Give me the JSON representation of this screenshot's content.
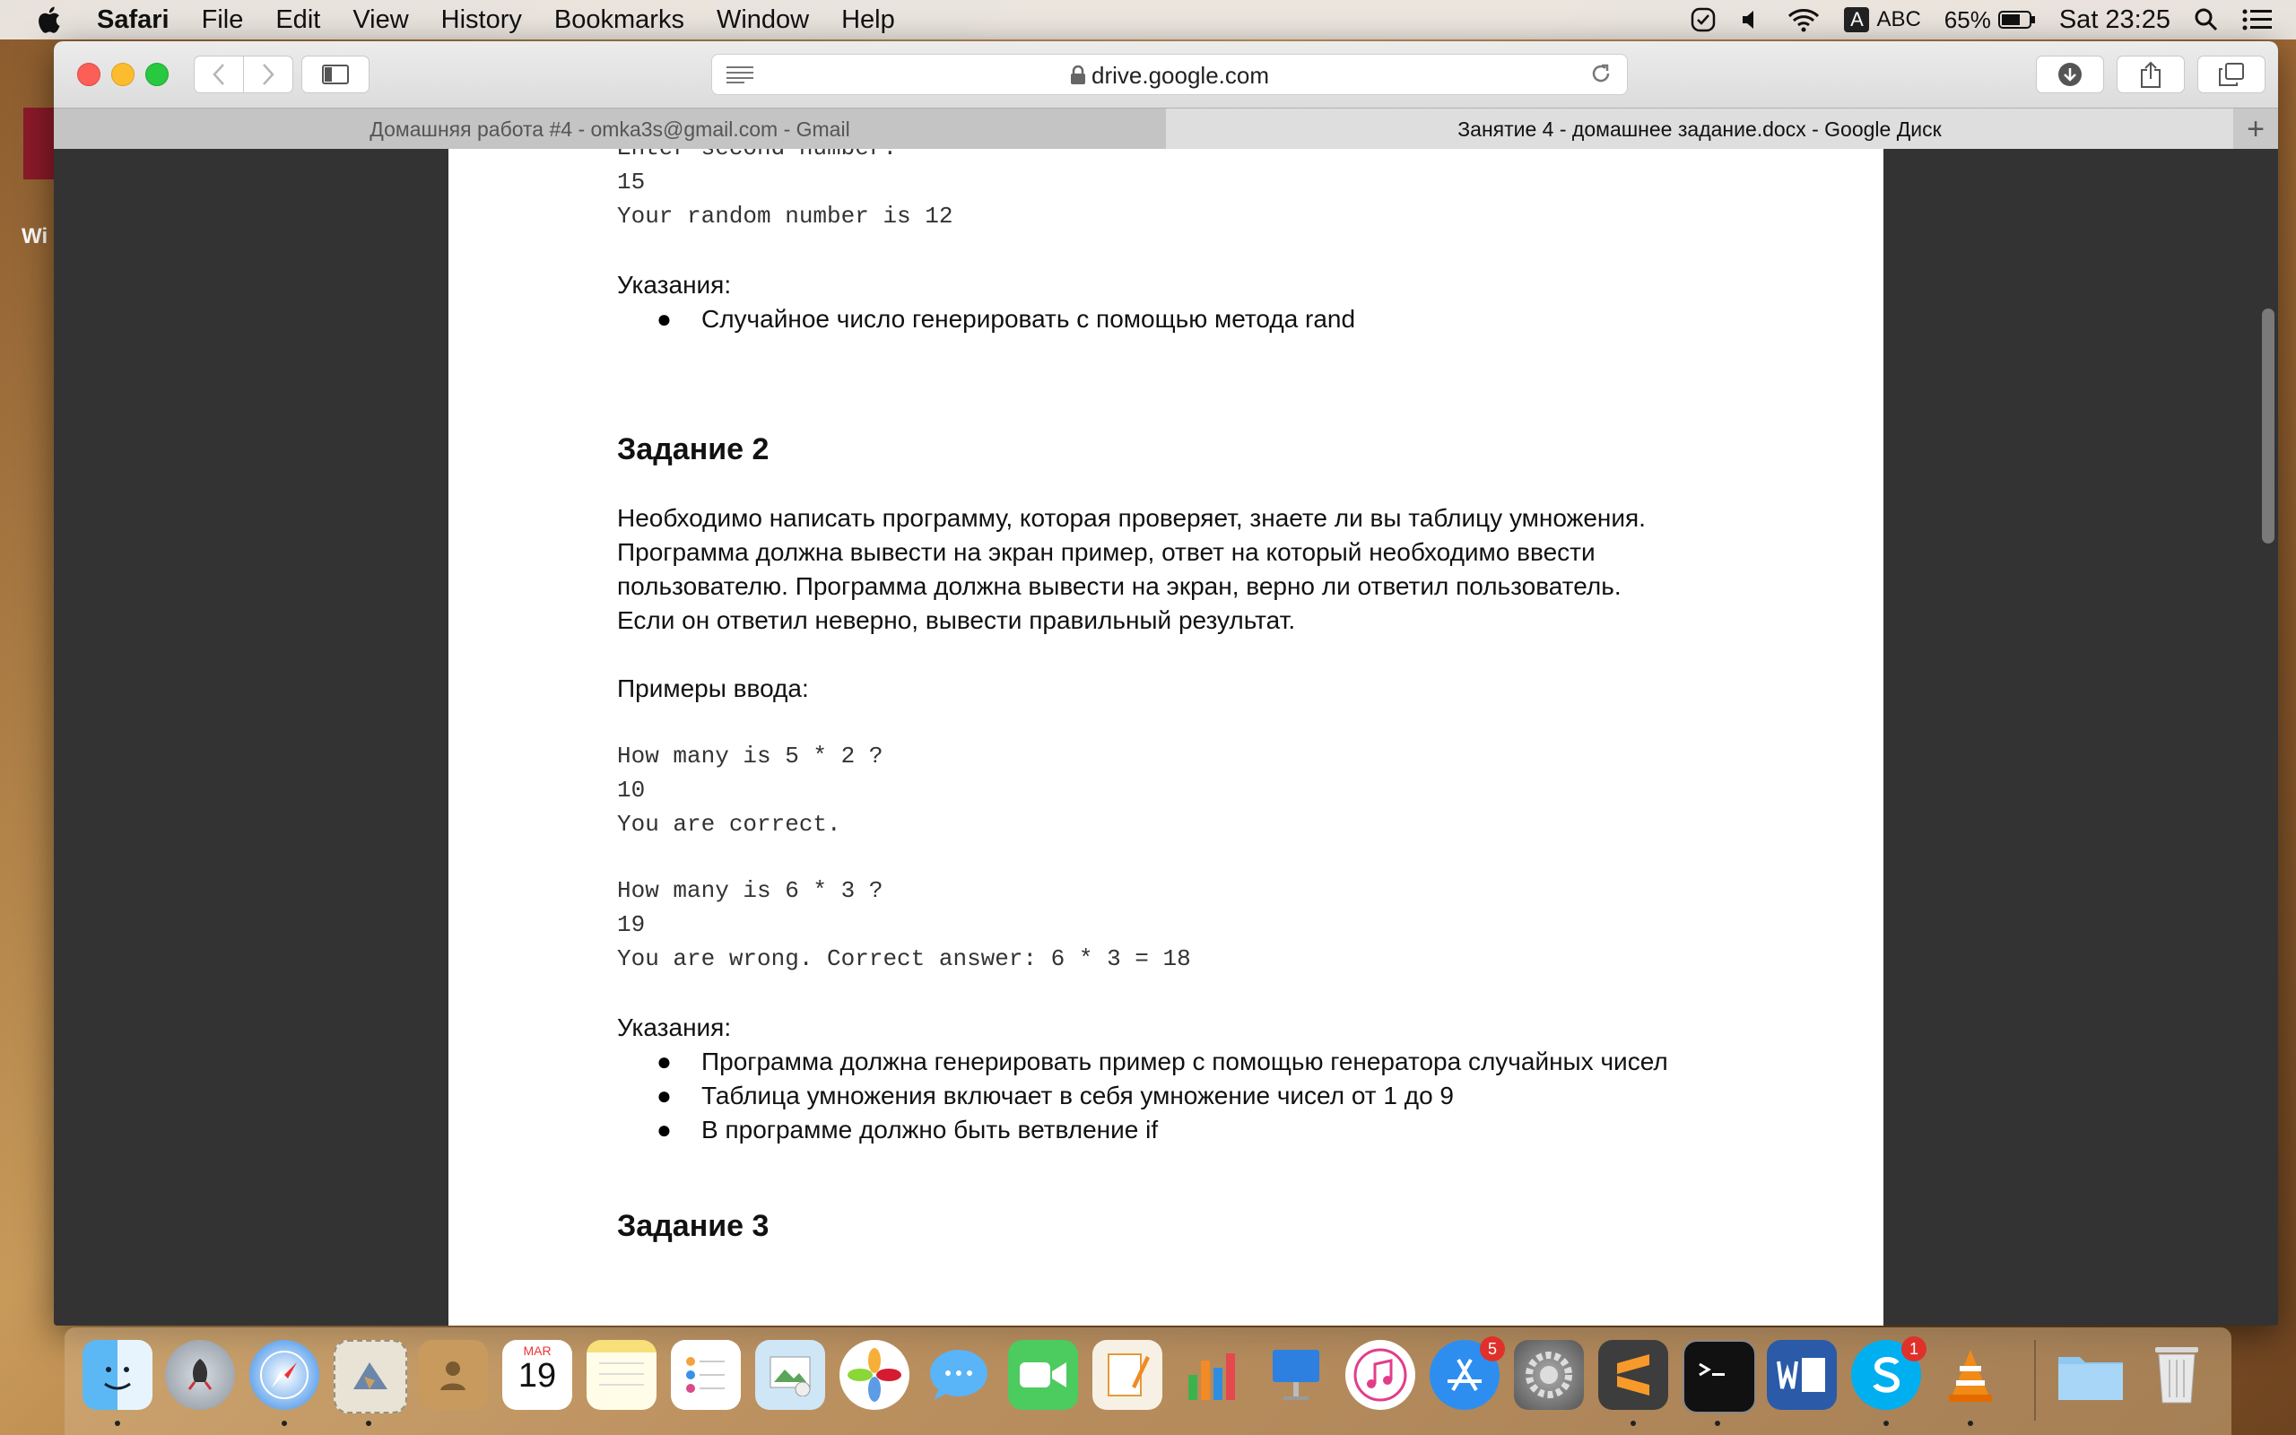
{
  "menubar": {
    "app_name": "Safari",
    "items": [
      "File",
      "Edit",
      "View",
      "History",
      "Bookmarks",
      "Window",
      "Help"
    ],
    "input_source": "ABC",
    "input_letter": "A",
    "battery": "65%",
    "clock": "Sat 23:25"
  },
  "desktop": {
    "label": "Wi"
  },
  "browser": {
    "url": "drive.google.com",
    "tabs": [
      {
        "title": "Домашняя работа #4 - omka3s@gmail.com - Gmail",
        "active": false
      },
      {
        "title": "Занятие 4 - домашнее задание.docx - Google Диск",
        "active": true
      }
    ],
    "new_tab": "+"
  },
  "document": {
    "code1": [
      "Enter second number:",
      "15",
      "Your random number is 12"
    ],
    "hints1_label": "Указания:",
    "hints1": [
      "Случайное число генерировать с помощью метода rand"
    ],
    "task2_title": "Задание 2",
    "task2_body": [
      "Необходимо написать программу, которая проверяет, знаете ли вы таблицу умножения.",
      "Программа должна вывести на экран пример, ответ на который необходимо ввести",
      "пользователю. Программа должна вывести на экран, верно ли ответил пользователь.",
      "Если он ответил неверно, вывести правильный результат."
    ],
    "examples_label": "Примеры ввода:",
    "example1": [
      "How many is 5 * 2 ?",
      "10",
      "You are correct."
    ],
    "example2": [
      "How many is 6 * 3 ?",
      "19",
      "You are wrong. Correct answer: 6 * 3 = 18"
    ],
    "hints2_label": "Указания:",
    "hints2": [
      "Программа должна генерировать пример с помощью генератора случайных чисел",
      "Таблица умножения включает в себя умножение чисел от 1 до 9",
      "В программе должно быть ветвление if"
    ],
    "task3_title": "Задание 3",
    "bullet": "●"
  },
  "dock": {
    "calendar_month": "MAR",
    "calendar_day": "19",
    "appstore_badge": "5",
    "skype_badge": "1"
  }
}
